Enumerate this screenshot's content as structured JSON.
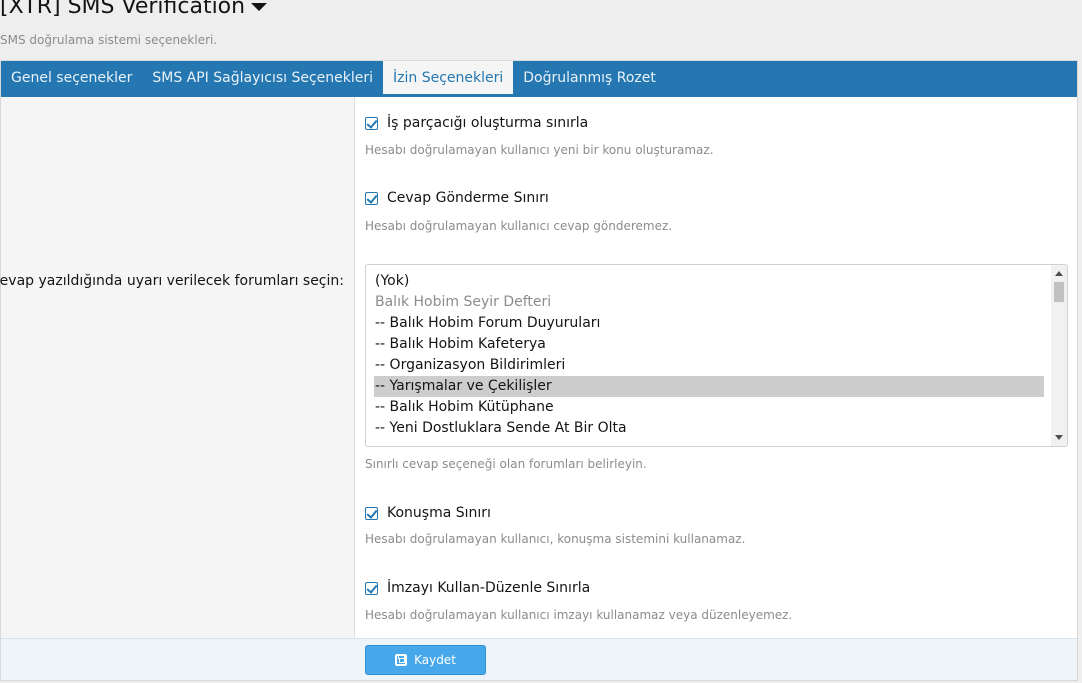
{
  "header": {
    "title": "[XTR] SMS Verification",
    "description": "SMS doğrulama sistemi seçenekleri."
  },
  "tabs": [
    {
      "label": "Genel seçenekler",
      "active": false
    },
    {
      "label": "SMS API Sağlayıcısı Seçenekleri",
      "active": false
    },
    {
      "label": "İzin Seçenekleri",
      "active": true
    },
    {
      "label": "Doğrulanmış Rozet",
      "active": false
    }
  ],
  "options": {
    "thread_limit": {
      "label": "İş parçacığı oluşturma sınırla",
      "checked": true,
      "hint": "Hesabı doğrulamayan kullanıcı yeni bir konu oluşturamaz."
    },
    "reply_limit": {
      "label": "Cevap Gönderme Sınırı",
      "checked": true,
      "hint": "Hesabı doğrulamayan kullanıcı cevap gönderemez."
    },
    "forums": {
      "row_label": "Cevap yazıldığında uyarı verilecek forumları seçin:",
      "items": [
        {
          "label": "(Yok)",
          "type": "option"
        },
        {
          "label": "Balık Hobim Seyir Defteri",
          "type": "group"
        },
        {
          "label": "-- Balık Hobim Forum Duyuruları",
          "type": "option"
        },
        {
          "label": "-- Balık Hobim Kafeterya",
          "type": "option"
        },
        {
          "label": "-- Organizasyon Bildirimleri",
          "type": "option"
        },
        {
          "label": "-- Yarışmalar ve Çekilişler",
          "type": "option",
          "selected": true
        },
        {
          "label": "-- Balık Hobim Kütüphane",
          "type": "option"
        },
        {
          "label": "-- Yeni Dostluklara Sende At Bir Olta",
          "type": "option"
        }
      ],
      "hint": "Sınırlı cevap seçeneği olan forumları belirleyin."
    },
    "conversation_limit": {
      "label": "Konuşma Sınırı",
      "checked": true,
      "hint": "Hesabı doğrulamayan kullanıcı, konuşma sistemini kullanamaz."
    },
    "signature_limit": {
      "label": "İmzayı Kullan-Düzenle Sınırla",
      "checked": true,
      "hint": "Hesabı doğrulamayan kullanıcı imzayı kullanamaz veya düzenleyemez."
    }
  },
  "footer": {
    "save_label": "Kaydet"
  },
  "icons": {
    "title_caret": "caret-down-icon",
    "save": "floppy-disk-icon"
  },
  "colors": {
    "tab_bar": "#2577b1",
    "save_button": "#47a7eb"
  }
}
